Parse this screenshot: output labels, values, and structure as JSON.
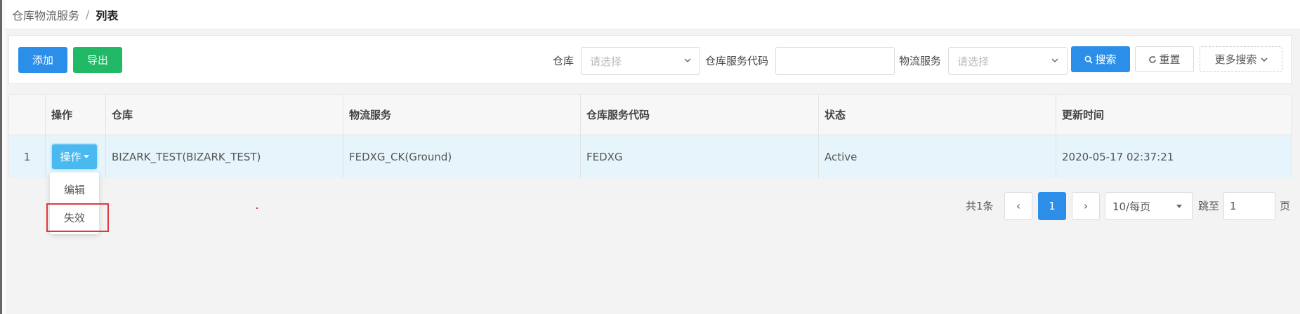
{
  "breadcrumb": {
    "parent": "仓库物流服务",
    "separator": "/",
    "current": "列表"
  },
  "toolbar": {
    "add_label": "添加",
    "export_label": "导出",
    "search_label": "搜索",
    "reset_label": "重置",
    "more_search_label": "更多搜索",
    "filters": {
      "warehouse_label": "仓库",
      "warehouse_placeholder": "请选择",
      "service_code_label": "仓库服务代码",
      "service_code_value": "",
      "logistics_label": "物流服务",
      "logistics_placeholder": "请选择"
    }
  },
  "table": {
    "columns": [
      "操作",
      "仓库",
      "物流服务",
      "仓库服务代码",
      "状态",
      "更新时间"
    ],
    "rows": [
      {
        "index": "1",
        "action_label": "操作",
        "warehouse": "BIZARK_TEST(BIZARK_TEST)",
        "logistics": "FEDXG_CK(Ground)",
        "code": "FEDXG",
        "status": "Active",
        "updated": "2020-05-17 02:37:21"
      }
    ]
  },
  "action_menu": {
    "items": [
      "编辑",
      "失效"
    ],
    "highlighted": "失效"
  },
  "pagination": {
    "total_text": "共1条",
    "prev": "‹",
    "current_page": "1",
    "next": "›",
    "page_size": "10/每页",
    "jump_label": "跳至",
    "jump_value": "1",
    "page_unit": "页"
  },
  "colors": {
    "primary": "#2b8ee8",
    "success": "#21b866",
    "row_highlight": "#e6f4fc",
    "highlight_box": "#e0383e"
  },
  "icons": {
    "search": "search-icon",
    "reset": "refresh-icon",
    "dropdown": "chevron-down-icon"
  }
}
